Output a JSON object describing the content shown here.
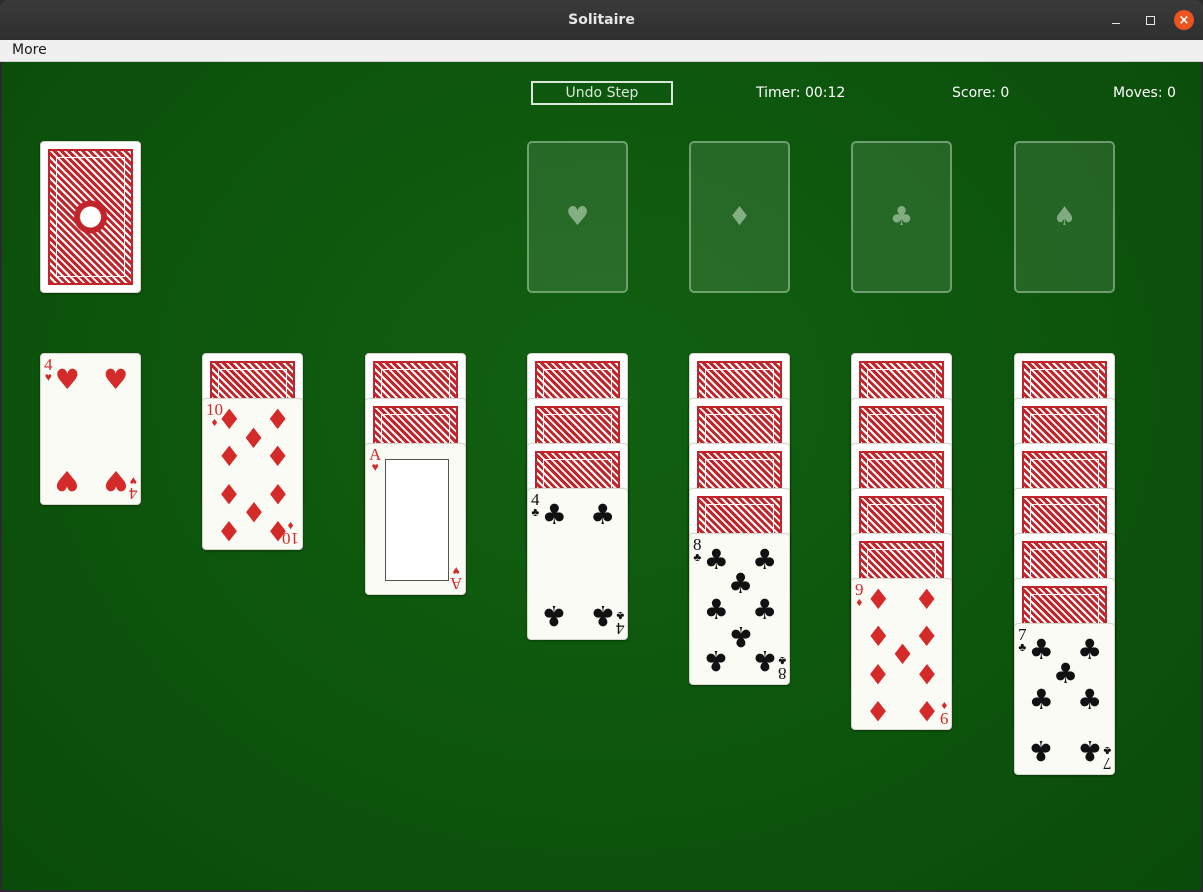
{
  "window": {
    "title": "Solitaire",
    "controls": {
      "minimize_icon": "minimize-icon",
      "maximize_icon": "maximize-icon",
      "close_glyph": "×"
    }
  },
  "menu": {
    "items": [
      "More"
    ]
  },
  "toolbar": {
    "undo_label": "Undo Step",
    "timer": "Timer: 00:12",
    "score": "Score: 0",
    "moves": "Moves: 0"
  },
  "stock": {
    "face": "down"
  },
  "foundations": [
    {
      "suit": "hearts",
      "glyph": "♥"
    },
    {
      "suit": "diamonds",
      "glyph": "♦"
    },
    {
      "suit": "clubs",
      "glyph": "♣"
    },
    {
      "suit": "spades",
      "glyph": "♠"
    }
  ],
  "tableau": [
    {
      "face_down": 0,
      "face_up": [
        {
          "rank": "4",
          "suit": "♥",
          "color": "red"
        }
      ]
    },
    {
      "face_down": 1,
      "face_up": [
        {
          "rank": "10",
          "suit": "♦",
          "color": "red"
        }
      ]
    },
    {
      "face_down": 2,
      "face_up": [
        {
          "rank": "A",
          "suit": "♥",
          "color": "red"
        }
      ]
    },
    {
      "face_down": 3,
      "face_up": [
        {
          "rank": "4",
          "suit": "♣",
          "color": "black"
        }
      ]
    },
    {
      "face_down": 4,
      "face_up": [
        {
          "rank": "8",
          "suit": "♣",
          "color": "black"
        }
      ]
    },
    {
      "face_down": 5,
      "face_up": [
        {
          "rank": "9",
          "suit": "♦",
          "color": "red"
        }
      ]
    },
    {
      "face_down": 6,
      "face_up": [
        {
          "rank": "7",
          "suit": "♣",
          "color": "black"
        }
      ]
    }
  ],
  "colors": {
    "table": "#0d550d",
    "red_suit": "#d42a2a",
    "card_back": "#c0252b",
    "close_button": "#e95420"
  }
}
